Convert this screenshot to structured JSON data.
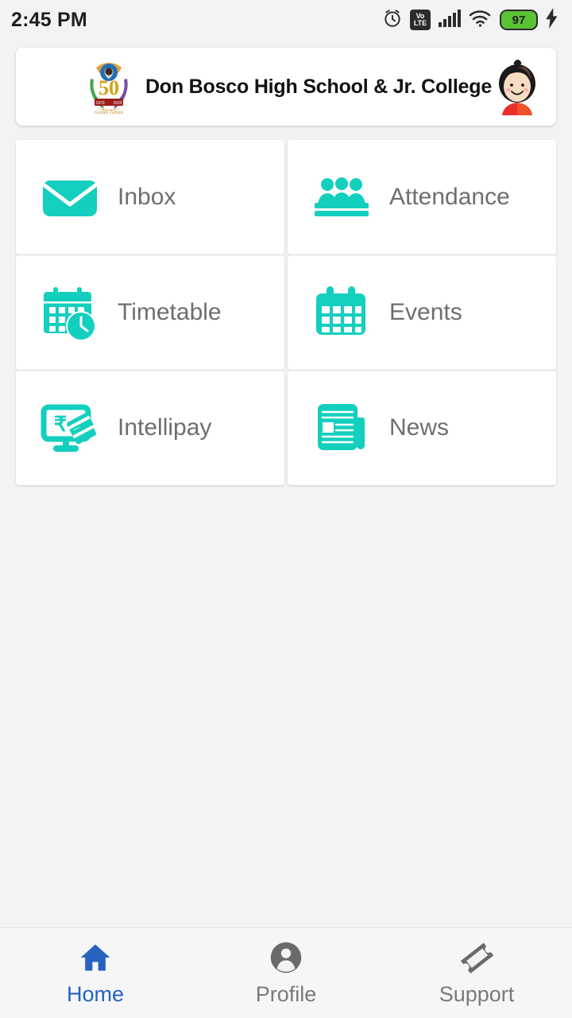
{
  "status_bar": {
    "time": "2:45 PM",
    "alarm_icon": "alarm-clock-icon",
    "volte_top": "Vo",
    "volte_bottom": "LTE",
    "signal_icon": "signal-bars-icon",
    "wifi_icon": "wifi-icon",
    "battery_level": "97",
    "charging_icon": "charging-bolt-icon"
  },
  "header": {
    "school_name": "Don Bosco High School & Jr. College",
    "logo_name": "school-logo-50th-anniversary",
    "logo_year_left": "1970",
    "logo_year_right": "2020",
    "logo_number": "50",
    "avatar_name": "student-avatar"
  },
  "tiles": [
    {
      "label": "Inbox",
      "icon": "envelope-icon"
    },
    {
      "label": "Attendance",
      "icon": "people-group-icon"
    },
    {
      "label": "Timetable",
      "icon": "calendar-clock-icon"
    },
    {
      "label": "Events",
      "icon": "calendar-icon"
    },
    {
      "label": "Intellipay",
      "icon": "online-payment-rupee-icon"
    },
    {
      "label": "News",
      "icon": "newspaper-icon"
    }
  ],
  "bottom_nav": [
    {
      "label": "Home",
      "icon": "home-icon",
      "active": true
    },
    {
      "label": "Profile",
      "icon": "person-icon",
      "active": false
    },
    {
      "label": "Support",
      "icon": "ticket-icon",
      "active": false
    }
  ],
  "colors": {
    "accent_teal": "#13CFBE",
    "active_blue": "#2663BF",
    "label_gray": "#6E6E6E",
    "page_background": "#F1F3F4",
    "card_background": "#FFFFFF",
    "battery_green": "#5BC236"
  }
}
